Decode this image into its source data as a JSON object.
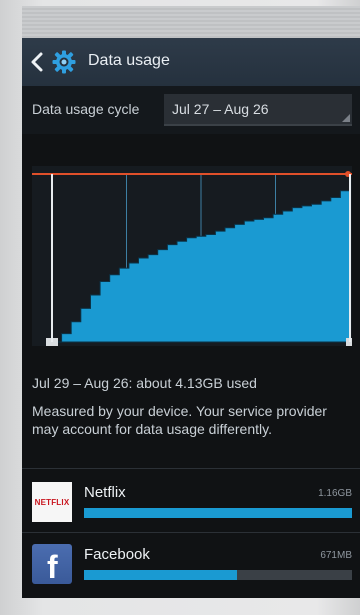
{
  "header": {
    "title": "Data usage"
  },
  "cycle": {
    "label": "Data usage cycle",
    "value": "Jul 27 – Aug 26"
  },
  "usage": {
    "range_summary": "Jul 29 – Aug 26: about 4.13GB used",
    "disclaimer": "Measured by your device. Your service provider may account for data usage differently."
  },
  "apps": [
    {
      "name": "Netflix",
      "size": "1.16GB",
      "fraction": 1.0,
      "icon": "netflix-icon",
      "icon_text": "NETFLIX"
    },
    {
      "name": "Facebook",
      "size": "671MB",
      "fraction": 0.57,
      "icon": "facebook-icon",
      "icon_text": "f"
    }
  ],
  "chart_data": {
    "type": "area",
    "description_cumulative_fraction": [
      0.0,
      0.05,
      0.12,
      0.2,
      0.28,
      0.36,
      0.4,
      0.44,
      0.47,
      0.5,
      0.52,
      0.55,
      0.58,
      0.6,
      0.62,
      0.63,
      0.64,
      0.66,
      0.68,
      0.7,
      0.72,
      0.73,
      0.74,
      0.76,
      0.78,
      0.8,
      0.81,
      0.82,
      0.84,
      0.86,
      0.9
    ],
    "ylim": [
      0,
      1
    ],
    "warning_line_fraction": 1.0
  },
  "colors": {
    "area_fill": "#1a9ad2",
    "area_edge": "#0b3347",
    "limit_line": "#e0502a",
    "accent": "#1a9ad2"
  }
}
